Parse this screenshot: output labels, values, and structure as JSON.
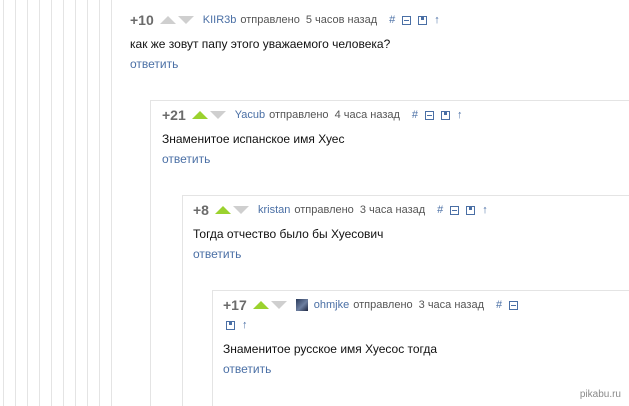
{
  "comments": [
    {
      "rating": "+10",
      "user": "KIIR3b",
      "sent_label": "отправлено",
      "time_ago": "5 часов назад",
      "text": "как же зовут папу этого уважаемого человека?",
      "reply_label": "ответить",
      "upvoted": false
    },
    {
      "rating": "+21",
      "user": "Yacub",
      "sent_label": "отправлено",
      "time_ago": "4 часа назад",
      "text": "Знаменитое испанское имя Хуес",
      "reply_label": "ответить",
      "upvoted": true
    },
    {
      "rating": "+8",
      "user": "kristan",
      "sent_label": "отправлено",
      "time_ago": "3 часа назад",
      "text": "Тогда отчество было бы Хуесович",
      "reply_label": "ответить",
      "upvoted": true
    },
    {
      "rating": "+17",
      "user": "ohmjke",
      "sent_label": "отправлено",
      "time_ago": "3 часа назад",
      "text": "Знаменитое русское имя Хуесос тогда",
      "reply_label": "ответить",
      "upvoted": true,
      "has_avatar": true
    }
  ],
  "icons": {
    "link": "#",
    "arrow": "↑"
  },
  "watermark": "pikabu.ru",
  "colors": {
    "link": "#4a6fa5",
    "upvote": "#9bd22e",
    "rating": "#6b6b6b",
    "lines": "#e4e4e4"
  }
}
